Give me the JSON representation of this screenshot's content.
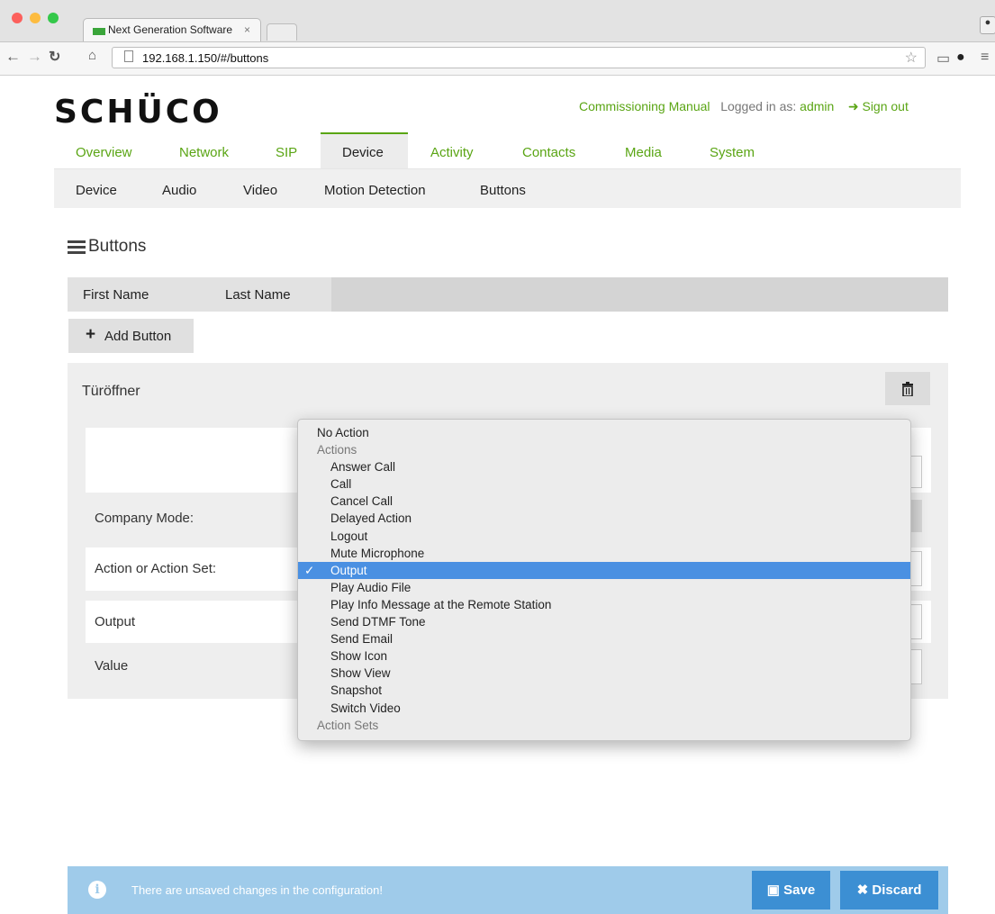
{
  "browser": {
    "tab_title": "Next Generation Software",
    "tab_close": "×",
    "url": "192.168.1.150/#/buttons"
  },
  "header": {
    "logo": "SCHÜCO",
    "manual_link": "Commissioning Manual",
    "logged_in_label": "Logged in as:",
    "user": "admin",
    "sign_out": "Sign out"
  },
  "main_nav": {
    "items": [
      "Overview",
      "Network",
      "SIP",
      "Device",
      "Activity",
      "Contacts",
      "Media",
      "System"
    ],
    "active": "Device"
  },
  "sub_nav": {
    "items": [
      "Device",
      "Audio",
      "Video",
      "Motion Detection",
      "Buttons"
    ]
  },
  "section": {
    "title": "Buttons",
    "columns": [
      "First Name",
      "Last Name"
    ],
    "add_button": "Add Button"
  },
  "entry": {
    "name": "Türöffner",
    "fields": {
      "company_mode": "Company Mode:",
      "action": "Action or Action Set:",
      "output": "Output",
      "value": "Value"
    }
  },
  "dropdown": {
    "no_action": "No Action",
    "group_actions": "Actions",
    "actions": [
      "Answer Call",
      "Call",
      "Cancel Call",
      "Delayed Action",
      "Logout",
      "Mute Microphone",
      "Output",
      "Play Audio File",
      "Play Info Message at the Remote Station",
      "Send DTMF Tone",
      "Send Email",
      "Show Icon",
      "Show View",
      "Snapshot",
      "Switch Video"
    ],
    "selected": "Output",
    "check": "✓",
    "group_action_sets": "Action Sets"
  },
  "footer": {
    "info_icon": "i",
    "message": "There are unsaved changes in the configuration!",
    "save": "Save",
    "discard": "Discard"
  },
  "colors": {
    "accent_green": "#5aa514",
    "selection_blue": "#4a90e2",
    "footer_blue": "#9fcbea",
    "button_blue": "#3c8fd3"
  }
}
